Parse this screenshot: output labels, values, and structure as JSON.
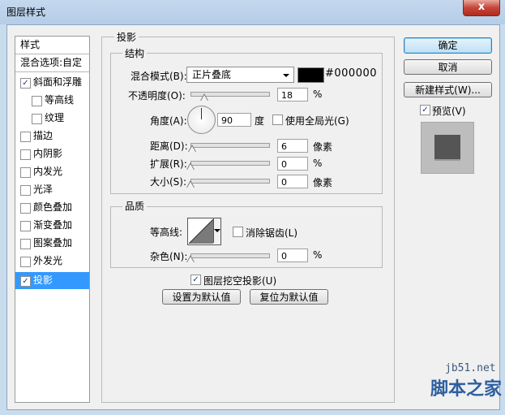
{
  "window": {
    "title": "图层样式",
    "close_label": "x"
  },
  "sidebar": {
    "items": [
      {
        "label": "样式"
      },
      {
        "label": "混合选项:自定"
      },
      {
        "label": "斜面和浮雕",
        "checked": true
      },
      {
        "label": "等高线",
        "checked": false
      },
      {
        "label": "纹理",
        "checked": false
      },
      {
        "label": "描边",
        "checked": false
      },
      {
        "label": "内阴影",
        "checked": false
      },
      {
        "label": "内发光",
        "checked": false
      },
      {
        "label": "光泽",
        "checked": false
      },
      {
        "label": "颜色叠加",
        "checked": false
      },
      {
        "label": "渐变叠加",
        "checked": false
      },
      {
        "label": "图案叠加",
        "checked": false
      },
      {
        "label": "外发光",
        "checked": false
      },
      {
        "label": "投影",
        "checked": true
      }
    ]
  },
  "shadow": {
    "section_title": "投影",
    "structure": {
      "title": "结构",
      "blend_mode_label": "混合模式(B):",
      "blend_mode_value": "正片叠底",
      "color_hex": "#000000",
      "color_swatch": "#000000",
      "opacity_label": "不透明度(O):",
      "opacity_value": "18",
      "opacity_unit": "%",
      "angle_label": "角度(A):",
      "angle_value": "90",
      "angle_unit": "度",
      "global_light_label": "使用全局光(G)",
      "global_light_checked": false,
      "distance_label": "距离(D):",
      "distance_value": "6",
      "distance_unit": "像素",
      "spread_label": "扩展(R):",
      "spread_value": "0",
      "spread_unit": "%",
      "size_label": "大小(S):",
      "size_value": "0",
      "size_unit": "像素"
    },
    "quality": {
      "title": "品质",
      "contour_label": "等高线:",
      "anti_alias_label": "消除锯齿(L)",
      "anti_alias_checked": false,
      "noise_label": "杂色(N):",
      "noise_value": "0",
      "noise_unit": "%"
    },
    "knockout_label": "图层挖空投影(U)",
    "knockout_checked": true,
    "make_default_label": "设置为默认值",
    "reset_default_label": "复位为默认值"
  },
  "buttons": {
    "ok": "确定",
    "cancel": "取消",
    "new_style": "新建样式(W)...",
    "preview_label": "预览(V)",
    "preview_checked": true
  },
  "watermark": {
    "site": "jb51.net",
    "name": "脚本之家"
  },
  "checkmark": "✓"
}
